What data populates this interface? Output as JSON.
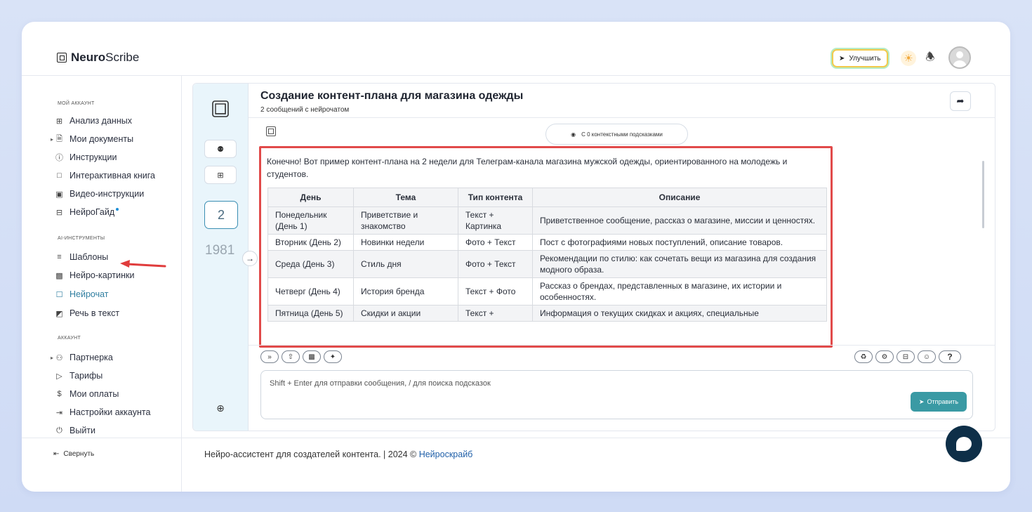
{
  "app": {
    "logo_bold": "Neuro",
    "logo_light": "Scribe",
    "upgrade_label": "Улучшить"
  },
  "sidebar": {
    "sections": [
      {
        "title": "МОЙ АККАУНТ"
      },
      {
        "title": "AI-ИНСТРУМЕНТЫ"
      },
      {
        "title": "АККАУНТ"
      }
    ],
    "items": [
      {
        "label": "Анализ данных",
        "icon": "grid-icon"
      },
      {
        "label": "Мои документы",
        "icon": "document-icon"
      },
      {
        "label": "Инструкции",
        "icon": "help-icon"
      },
      {
        "label": "Интерактивная книга",
        "icon": "book-icon"
      },
      {
        "label": "Видео-инструкции",
        "icon": "video-icon"
      },
      {
        "label": "НейроГайд",
        "icon": "table-icon"
      },
      {
        "label": "Шаблоны",
        "icon": "layers-icon"
      },
      {
        "label": "Нейро-картинки",
        "icon": "image-icon"
      },
      {
        "label": "Нейрочат",
        "icon": "chat-icon"
      },
      {
        "label": "Речь в текст",
        "icon": "headphones-icon"
      },
      {
        "label": "Партнерка",
        "icon": "users-icon"
      },
      {
        "label": "Тарифы",
        "icon": "tag-icon"
      },
      {
        "label": "Мои оплаты",
        "icon": "dollar-icon"
      },
      {
        "label": "Настройки аккаунта",
        "icon": "login-icon"
      },
      {
        "label": "Выйти",
        "icon": "power-icon"
      }
    ],
    "collapse_label": "Свернуть"
  },
  "chat": {
    "left": {
      "count": "2",
      "year": "1981"
    },
    "title": "Создание контент-плана для магазина одежды",
    "subtitle": "2 сообщений с нейрочатом",
    "hints_label": "С 0 контекстными подсказками",
    "message_intro": "Конечно! Вот пример контент-плана на 2 недели для Телеграм-канала магазина мужской одежды, ориентированного на молодежь и студентов.",
    "table": {
      "headers": [
        "День",
        "Тема",
        "Тип контента",
        "Описание"
      ],
      "rows": [
        [
          "Понедельник (День 1)",
          "Приветствие и знакомство",
          "Текст + Картинка",
          "Приветственное сообщение, рассказ о магазине, миссии и ценностях."
        ],
        [
          "Вторник (День 2)",
          "Новинки недели",
          "Фото + Текст",
          "Пост с фотографиями новых поступлений, описание товаров."
        ],
        [
          "Среда (День 3)",
          "Стиль дня",
          "Фото + Текст",
          "Рекомендации по стилю: как сочетать вещи из магазина для создания модного образа."
        ],
        [
          "Четверг (День 4)",
          "История бренда",
          "Текст + Фото",
          "Рассказ о брендах, представленных в магазине, их истории и особенностях."
        ],
        [
          "Пятница (День 5)",
          "Скидки и акции",
          "Текст +",
          "Информация о текущих скидках и акциях, специальные"
        ]
      ]
    },
    "input_placeholder": "Shift + Enter для отправки сообщения, / для поиска подсказок",
    "send_label": "Отправить",
    "help_label": "?"
  },
  "footer": {
    "text": "Нейро-ассистент для создателей контента.  | 2024 © ",
    "link": "Нейроскрайб"
  },
  "colors": {
    "accent": "#3a9aa4",
    "highlight_border": "#e14a4a",
    "active_nav": "#2f7ea0"
  }
}
